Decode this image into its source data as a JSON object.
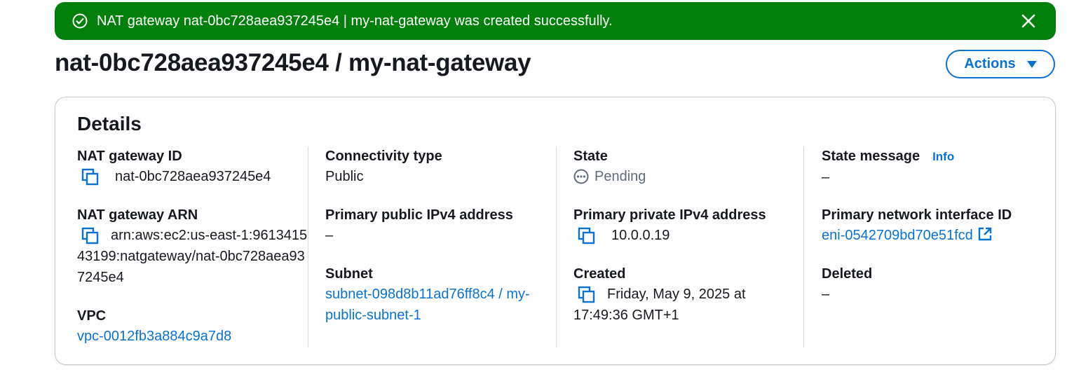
{
  "flash": {
    "message": "NAT gateway nat-0bc728aea937245e4 | my-nat-gateway was created successfully.",
    "status_icon": "success-check-circle-icon",
    "close_icon": "close-icon",
    "color": "#037f0c"
  },
  "header": {
    "title": "nat-0bc728aea937245e4 / my-nat-gateway",
    "actions_label": "Actions"
  },
  "details": {
    "title": "Details",
    "nat_gateway_id": {
      "label": "NAT gateway ID",
      "value": "nat-0bc728aea937245e4"
    },
    "nat_gateway_arn": {
      "label": "NAT gateway ARN",
      "value": "arn:aws:ec2:us-east-1:961341543199:natgateway/nat-0bc728aea937245e4"
    },
    "vpc": {
      "label": "VPC",
      "value": "vpc-0012fb3a884c9a7d8"
    },
    "connectivity_type": {
      "label": "Connectivity type",
      "value": "Public"
    },
    "primary_public_ipv4": {
      "label": "Primary public IPv4 address",
      "value": "–"
    },
    "subnet": {
      "label": "Subnet",
      "value": "subnet-098d8b11ad76ff8c4 / my-public-subnet-1"
    },
    "state": {
      "label": "State",
      "value": "Pending"
    },
    "primary_private_ipv4": {
      "label": "Primary private IPv4 address",
      "value": "10.0.0.19"
    },
    "created": {
      "label": "Created",
      "value": "Friday, May 9, 2025 at 17:49:36 GMT+1"
    },
    "state_message": {
      "label": "State message",
      "info": "Info",
      "value": "–"
    },
    "primary_eni": {
      "label": "Primary network interface ID",
      "value": "eni-0542709bd70e51fcd"
    },
    "deleted": {
      "label": "Deleted",
      "value": "–"
    }
  },
  "colors": {
    "link": "#0972d3",
    "text": "#16191f",
    "muted": "#5f6b7a",
    "border": "#c6c6cd"
  }
}
